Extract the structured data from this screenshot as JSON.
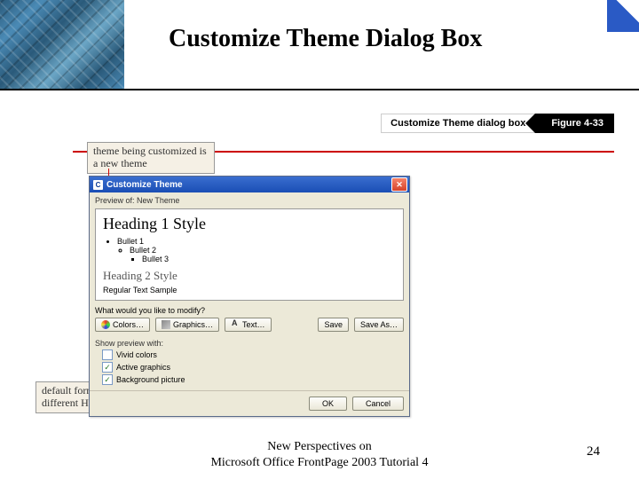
{
  "header": {
    "title": "Customize Theme Dialog Box"
  },
  "figure_bar": {
    "caption": "Customize Theme dialog box",
    "tag": "Figure 4-33"
  },
  "callouts": {
    "top": "theme being customized is a new theme",
    "bottom": "default formatting for different HTML styles"
  },
  "dialog": {
    "title_icon_letter": "C",
    "title": "Customize Theme",
    "preview_label": "Preview of: New Theme",
    "preview": {
      "heading1": "Heading 1 Style",
      "bullet1": "Bullet 1",
      "bullet2": "Bullet 2",
      "bullet3": "Bullet 3",
      "heading2": "Heading 2 Style",
      "regular": "Regular Text Sample"
    },
    "modify_label": "What would you like to modify?",
    "buttons": {
      "colors": "Colors…",
      "graphics": "Graphics…",
      "text": "Text…",
      "save": "Save",
      "save_as": "Save As…"
    },
    "show_preview_label": "Show preview with:",
    "checkboxes": {
      "vivid_label": "Vivid colors",
      "vivid_checked": false,
      "active_label": "Active graphics",
      "active_checked": true,
      "bg_label": "Background picture",
      "bg_checked": true
    },
    "footer_buttons": {
      "ok": "OK",
      "cancel": "Cancel"
    }
  },
  "footer": {
    "line1": "New Perspectives on",
    "line2": "Microsoft Office FrontPage 2003 Tutorial 4",
    "page_number": "24"
  }
}
